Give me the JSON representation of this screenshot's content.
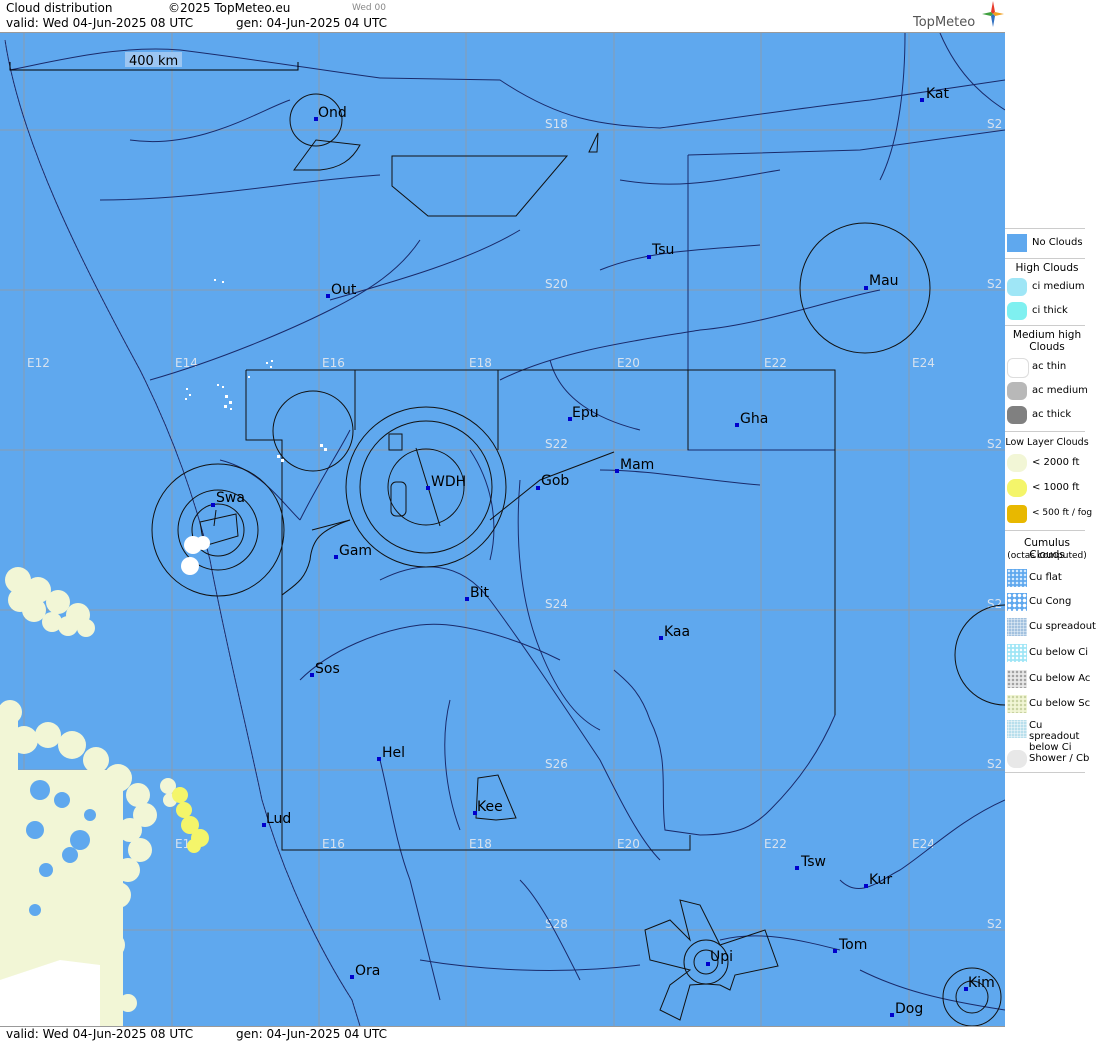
{
  "header": {
    "title": "Cloud distribution",
    "copyright": "©2025 TopMeteo.eu",
    "run": "Wed 00",
    "valid": "valid:  Wed  04-Jun-2025  08 UTC",
    "gen": "gen: 04-Jun-2025 04 UTC",
    "brand": "TopMeteo"
  },
  "footer": {
    "valid": "valid:  Wed  04-Jun-2025  08 UTC",
    "gen": "gen: 04-Jun-2025 04 UTC"
  },
  "scale": {
    "label": "400 km"
  },
  "grid": {
    "lon_labels": [
      "E12",
      "E14",
      "E16",
      "E18",
      "E20",
      "E22",
      "E24"
    ],
    "lat_labels": [
      "S18",
      "S20",
      "S22",
      "S24",
      "S26",
      "S28"
    ],
    "right_edge_label": "S2"
  },
  "cities": [
    {
      "name": "Ond"
    },
    {
      "name": "Kat"
    },
    {
      "name": "Tsu"
    },
    {
      "name": "Out"
    },
    {
      "name": "Mau"
    },
    {
      "name": "Epu"
    },
    {
      "name": "Gha"
    },
    {
      "name": "Mam"
    },
    {
      "name": "Swa"
    },
    {
      "name": "WDH"
    },
    {
      "name": "Gob"
    },
    {
      "name": "Gam"
    },
    {
      "name": "Bit"
    },
    {
      "name": "Kaa"
    },
    {
      "name": "Sos"
    },
    {
      "name": "Hel"
    },
    {
      "name": "Kee"
    },
    {
      "name": "Lud"
    },
    {
      "name": "Tsw"
    },
    {
      "name": "Kur"
    },
    {
      "name": "Tom"
    },
    {
      "name": "Upi"
    },
    {
      "name": "Ora"
    },
    {
      "name": "Kim"
    },
    {
      "name": "Dog"
    }
  ],
  "legend": {
    "no_clouds": "No Clouds",
    "high_header": "High Clouds",
    "ci_medium": "ci medium",
    "ci_thick": "ci thick",
    "medium_header": "Medium high Clouds",
    "ac_thin": "ac thin",
    "ac_medium": "ac medium",
    "ac_thick": "ac thick",
    "low_header": "Low Layer Clouds",
    "low_2000": "< 2000 ft",
    "low_1000": "< 1000 ft",
    "low_500": "< 500 ft / fog",
    "cumulus_header": "Cumulus Clouds",
    "cumulus_sub": "(octas computed)",
    "cu_flat": "Cu flat",
    "cu_cong": "Cu Cong",
    "cu_spreadout": "Cu spreadout",
    "cu_below_ci": "Cu below Ci",
    "cu_below_ac": "Cu below Ac",
    "cu_below_sc": "Cu below Sc",
    "cu_spreadout_below_ci": "Cu spreadout below Ci",
    "shower_cb": "Shower / Cb",
    "colors": {
      "no_clouds": "#5fa8ee",
      "low_2000": "#f2f6d6",
      "low_1000": "#f4f56a",
      "low_500": "#e8b800",
      "ac_medium": "#b8b8b8",
      "ac_thick": "#808080"
    }
  },
  "colors": {
    "sea_land": "#5fa8ee",
    "grid": "#8a9bb0",
    "lines": "#1a2a6a",
    "low_cloud": "#f2f6d6",
    "yellow_cloud": "#f4f56a"
  }
}
